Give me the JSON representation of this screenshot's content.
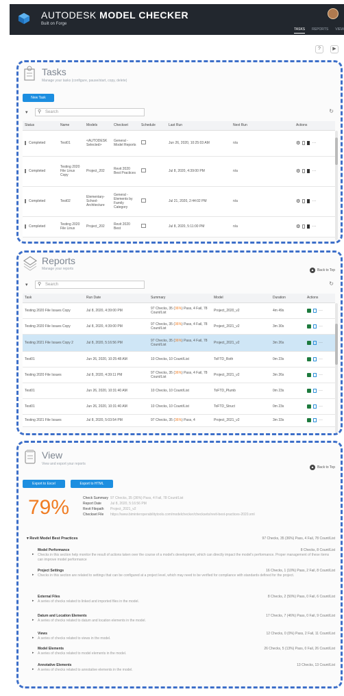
{
  "app": {
    "brand": "AUTODESK",
    "title": "MODEL CHECKER",
    "subtitle": "Built on Forge",
    "nav": [
      "TASKS",
      "REPORTS",
      "VIEW"
    ],
    "nav_active": "TASKS"
  },
  "util": {
    "help_icon": "?",
    "video_icon": "▶"
  },
  "tasks": {
    "title": "Tasks",
    "subtitle": "Manage your tasks (configure, pause/start, copy, delete)",
    "new_task_label": "New Task",
    "search_placeholder": "Search",
    "columns": [
      "Status",
      "Name",
      "Models",
      "Checkset",
      "Schedule",
      "Last Run",
      "Next Run",
      "Actions"
    ],
    "rows": [
      {
        "status": "Completed",
        "name": "Test01",
        "models": "<AUTODESK Selected>",
        "checkset": "General - Model Reports",
        "last_run": "Jun 26, 2020, 10:25:03 AM",
        "next_run": "n/a"
      },
      {
        "status": "Completed",
        "name": "Testing 2020 File Linux Copy",
        "models": "Project_202",
        "checkset": "Revit 2020 Best Practices",
        "last_run": "Jul 8, 2020, 4:39:00 PM",
        "next_run": "n/a"
      },
      {
        "status": "Completed",
        "name": "Test02",
        "models": "Elementary-School-Architecture",
        "checkset": "General - Elements by Family Category",
        "last_run": "Jul 21, 2020, 2:44:02 PM",
        "next_run": "n/a"
      },
      {
        "status": "Completed",
        "name": "Testing 2020 File Linux",
        "models": "Project_202",
        "checkset": "Revit 2020 Best",
        "last_run": "Jul 8, 2020, 5:11:00 PM",
        "next_run": "n/a"
      }
    ]
  },
  "reports": {
    "title": "Reports",
    "subtitle": "Manage your reports",
    "back_to_top": "Back to Top",
    "search_placeholder": "Search",
    "columns": [
      "Task",
      "Run Date",
      "Summary",
      "Model",
      "Duration",
      "Actions"
    ],
    "rows": [
      {
        "task": "Testing 2020 File Issues Copy",
        "date": "Jul 8, 2020, 4:39:00 PM",
        "summary_a": "97 Checks, 35 (",
        "summary_pct": "36%",
        "summary_b": ") Pass, 4 Fail, 78 Count/List",
        "model": "Project_2020_v2",
        "duration": "4m 49s",
        "selected": false
      },
      {
        "task": "Testing 2020 File Issues Copy",
        "date": "Jul 8, 2020, 4:39:00 PM",
        "summary_a": "97 Checks, 35 (",
        "summary_pct": "36%",
        "summary_b": ") Pass, 4 Fail, 78 Count/List",
        "model": "Project_2021_v2",
        "duration": "3m 30s",
        "selected": false
      },
      {
        "task": "Testing 2021 File Issues Copy 2",
        "date": "Jul 8, 2020, 5:16:56 PM",
        "summary_a": "97 Checks, 35 (",
        "summary_pct": "36%",
        "summary_b": ") Pass, 4 Fail, 78 Count/List",
        "model": "Project_2021_v2",
        "duration": "3m 26s",
        "selected": true
      },
      {
        "task": "Test01",
        "date": "Jun 26, 2020, 10:25:48 AM",
        "summary_a": "10 Checks, 10 Count/List",
        "summary_pct": "",
        "summary_b": "",
        "model": "ToFTD_Roth",
        "duration": "0m 23s",
        "selected": false
      },
      {
        "task": "Testing 2020 File Issues",
        "date": "Jul 8, 2020, 4:39:11 PM",
        "summary_a": "97 Checks, 35 (",
        "summary_pct": "36%",
        "summary_b": ") Pass, 4 Fail, 78 Count/List",
        "model": "Project_2021_v2",
        "duration": "3m 26s",
        "selected": false
      },
      {
        "task": "Test01",
        "date": "Jun 26, 2020, 10:31:40 AM",
        "summary_a": "10 Checks, 10 Count/List",
        "summary_pct": "",
        "summary_b": "",
        "model": "ToFTD_Plumb",
        "duration": "0m 23s",
        "selected": false
      },
      {
        "task": "Test01",
        "date": "Jun 26, 2020, 10:31:40 AM",
        "summary_a": "10 Checks, 10 Count/List",
        "summary_pct": "",
        "summary_b": "",
        "model": "ToFTD_Struct",
        "duration": "0m 23s",
        "selected": false
      },
      {
        "task": "Testing 2021 File Issues",
        "date": "Jul 8, 2020, 5:03:54 PM",
        "summary_a": "97 Checks, 35 (",
        "summary_pct": "36%",
        "summary_b": ") Pass, 4",
        "model": "Project_2021_v2",
        "duration": "3m 33s",
        "selected": false
      }
    ]
  },
  "view": {
    "title": "View",
    "subtitle": "View and export your reports",
    "back_to_top": "Back to Top",
    "export_excel": "Export to Excel",
    "export_html": "Export to HTML",
    "percent": "79%",
    "kv": [
      {
        "k": "Check Summary",
        "v": "97 Checks, 35 (36%) Pass, 4 Fail, 78 Count/List"
      },
      {
        "k": "Report Date",
        "v": "Jul 8, 2020, 5:16:56 PM"
      },
      {
        "k": "Revit Filepath",
        "v": "Project_2021_v2"
      },
      {
        "k": "Checkset File",
        "v": "https://www.biminteroperabilitytools.com/modelchecker/checksets/revit-best-practices-2020.xml"
      }
    ],
    "group_title": "Revit Model Best Practices",
    "group_summary": "97 Checks, 35 (36%) Pass, 4 Fail, 78 Count/List",
    "items": [
      {
        "name": "Model Performance",
        "desc": "Checks in this section help monitor the result of actions taken over the course of a model's development, which can directly impact the model's performance. Proper management of these items can improve model performance",
        "res": "8 Checks, 8 Count/List"
      },
      {
        "name": "Project Settings",
        "desc": "Checks in this section are related to settings that can be configured at a project level, which may need to be verified for compliance with standards defined for the project.",
        "res": "16 Checks, 1 (10%) Pass, 2 Fail, 8 Count/List"
      },
      {
        "name": "External Files",
        "desc": "A series of checks related to linked and imported files in the model.",
        "res": "8 Checks, 2 (50%) Pass, 0 Fail, 6 Count/List"
      },
      {
        "name": "Datum and Location Elements",
        "desc": "A series of checks related to datum and location elements in the model.",
        "res": "17 Checks, 7 (46%) Pass, 0 Fail, 9 Count/List"
      },
      {
        "name": "Views",
        "desc": "A series of checks related to views in the model.",
        "res": "12 Checks, 0 (0%) Pass, 2 Fail, 11 Count/List"
      },
      {
        "name": "Model Elements",
        "desc": "A series of checks related to model elements in the model.",
        "res": "26 Checks, 5 (13%) Pass, 0 Fail, 26 Count/List"
      },
      {
        "name": "Annotative Elements",
        "desc": "A series of checks related to annotative elements in the model.",
        "res": "13 Checks, 13 Count/List"
      }
    ]
  },
  "colors": {
    "accent": "#1c8ee0",
    "dashed_border": "#3d6fc9",
    "percent": "#f07c22",
    "topbar": "#22272e",
    "selected_row": "#cfe6f6"
  }
}
